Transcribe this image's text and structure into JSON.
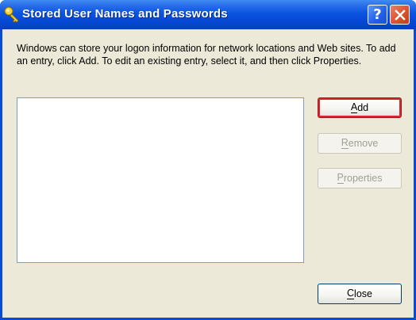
{
  "window": {
    "title": "Stored User Names and Passwords",
    "icon": "key-icon",
    "help_glyph": "?",
    "close_glyph": "close-x"
  },
  "dialog": {
    "description": "Windows can store your logon information for network locations and Web sites. To add an entry, click Add. To edit an existing entry, select it, and then click Properties.",
    "entries": [],
    "buttons": {
      "add": {
        "mnemonic": "A",
        "rest": "dd",
        "enabled": true,
        "default": true
      },
      "remove": {
        "mnemonic": "R",
        "rest": "emove",
        "enabled": false
      },
      "properties": {
        "mnemonic": "P",
        "rest": "roperties",
        "enabled": false
      },
      "close": {
        "mnemonic": "C",
        "rest": "lose",
        "enabled": true
      }
    }
  },
  "colors": {
    "titlebar": "#0a54e0",
    "client_bg": "#ece9d8",
    "default_focus": "#d9252d"
  }
}
